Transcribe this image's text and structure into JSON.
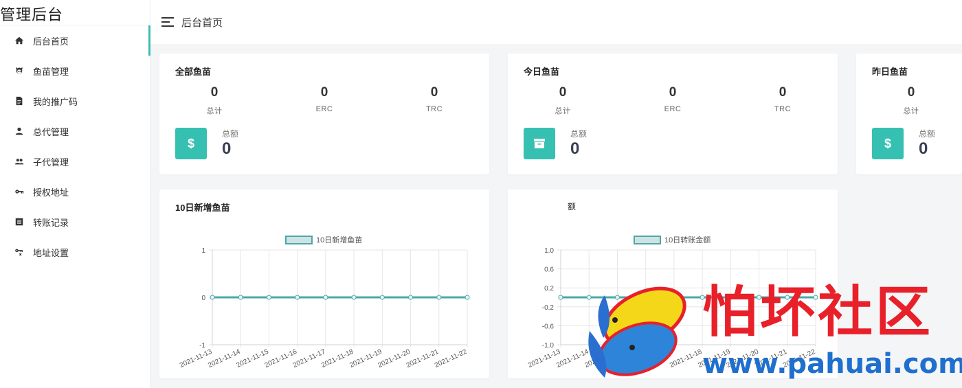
{
  "app": {
    "title": "管理后台"
  },
  "sidebar": {
    "items": [
      {
        "label": "后台首页",
        "icon": "home-icon",
        "active": true
      },
      {
        "label": "鱼苗管理",
        "icon": "fish-icon",
        "active": false
      },
      {
        "label": "我的推广码",
        "icon": "document-icon",
        "active": false
      },
      {
        "label": "总代管理",
        "icon": "user-icon",
        "active": false
      },
      {
        "label": "子代管理",
        "icon": "users-icon",
        "active": false
      },
      {
        "label": "授权地址",
        "icon": "key-icon",
        "active": false
      },
      {
        "label": "转账记录",
        "icon": "list-icon",
        "active": false
      },
      {
        "label": "地址设置",
        "icon": "key-settings-icon",
        "active": false
      }
    ]
  },
  "header": {
    "title": "后台首页"
  },
  "cards": [
    {
      "title": "全部鱼苗",
      "stats": [
        {
          "value": "0",
          "label": "总计"
        },
        {
          "value": "0",
          "label": "ERC"
        },
        {
          "value": "0",
          "label": "TRC"
        }
      ],
      "total_label": "总额",
      "total_value": "0",
      "icon": "dollar-icon"
    },
    {
      "title": "今日鱼苗",
      "stats": [
        {
          "value": "0",
          "label": "总计"
        },
        {
          "value": "0",
          "label": "ERC"
        },
        {
          "value": "0",
          "label": "TRC"
        }
      ],
      "total_label": "总额",
      "total_value": "0",
      "icon": "archive-icon"
    },
    {
      "title": "昨日鱼苗",
      "stats": [
        {
          "value": "0",
          "label": "总计"
        }
      ],
      "total_label": "总额",
      "total_value": "0",
      "icon": "dollar-icon"
    }
  ],
  "colors": {
    "accent": "#36c0b1",
    "line": "#4aa8a8"
  },
  "chart_data": [
    {
      "type": "line",
      "title": "10日新增鱼苗",
      "x": [
        "2021-11-13",
        "2021-11-14",
        "2021-11-15",
        "2021-11-16",
        "2021-11-17",
        "2021-11-18",
        "2021-11-19",
        "2021-11-20",
        "2021-11-21",
        "2021-11-22"
      ],
      "series": [
        {
          "name": "10日新增鱼苗",
          "values": [
            0,
            0,
            0,
            0,
            0,
            0,
            0,
            0,
            0,
            0
          ]
        }
      ],
      "yticks": [
        "1",
        "0",
        "-1"
      ],
      "ylim": [
        -1,
        1
      ],
      "legend": "top-center",
      "grid": true
    },
    {
      "type": "line",
      "title": "额",
      "x": [
        "2021-11-13",
        "2021-11-14",
        "2021-11-15",
        "2021-11-16",
        "2021-11-17",
        "2021-11-18",
        "2021-11-19",
        "2021-11-20",
        "2021-11-21",
        "2021-11-22"
      ],
      "series": [
        {
          "name": "10日转账金额",
          "values": [
            0,
            0,
            0,
            0,
            0,
            0,
            0,
            0,
            0,
            0
          ]
        }
      ],
      "yticks": [
        "1.0",
        "0.6",
        "0.2",
        "-0.2",
        "-0.6",
        "-1.0"
      ],
      "ylim": [
        -1,
        1
      ],
      "legend": "top-center",
      "grid": true
    }
  ],
  "watermark": {
    "text": "怕坏社区",
    "url": "www.pahuai.com"
  }
}
